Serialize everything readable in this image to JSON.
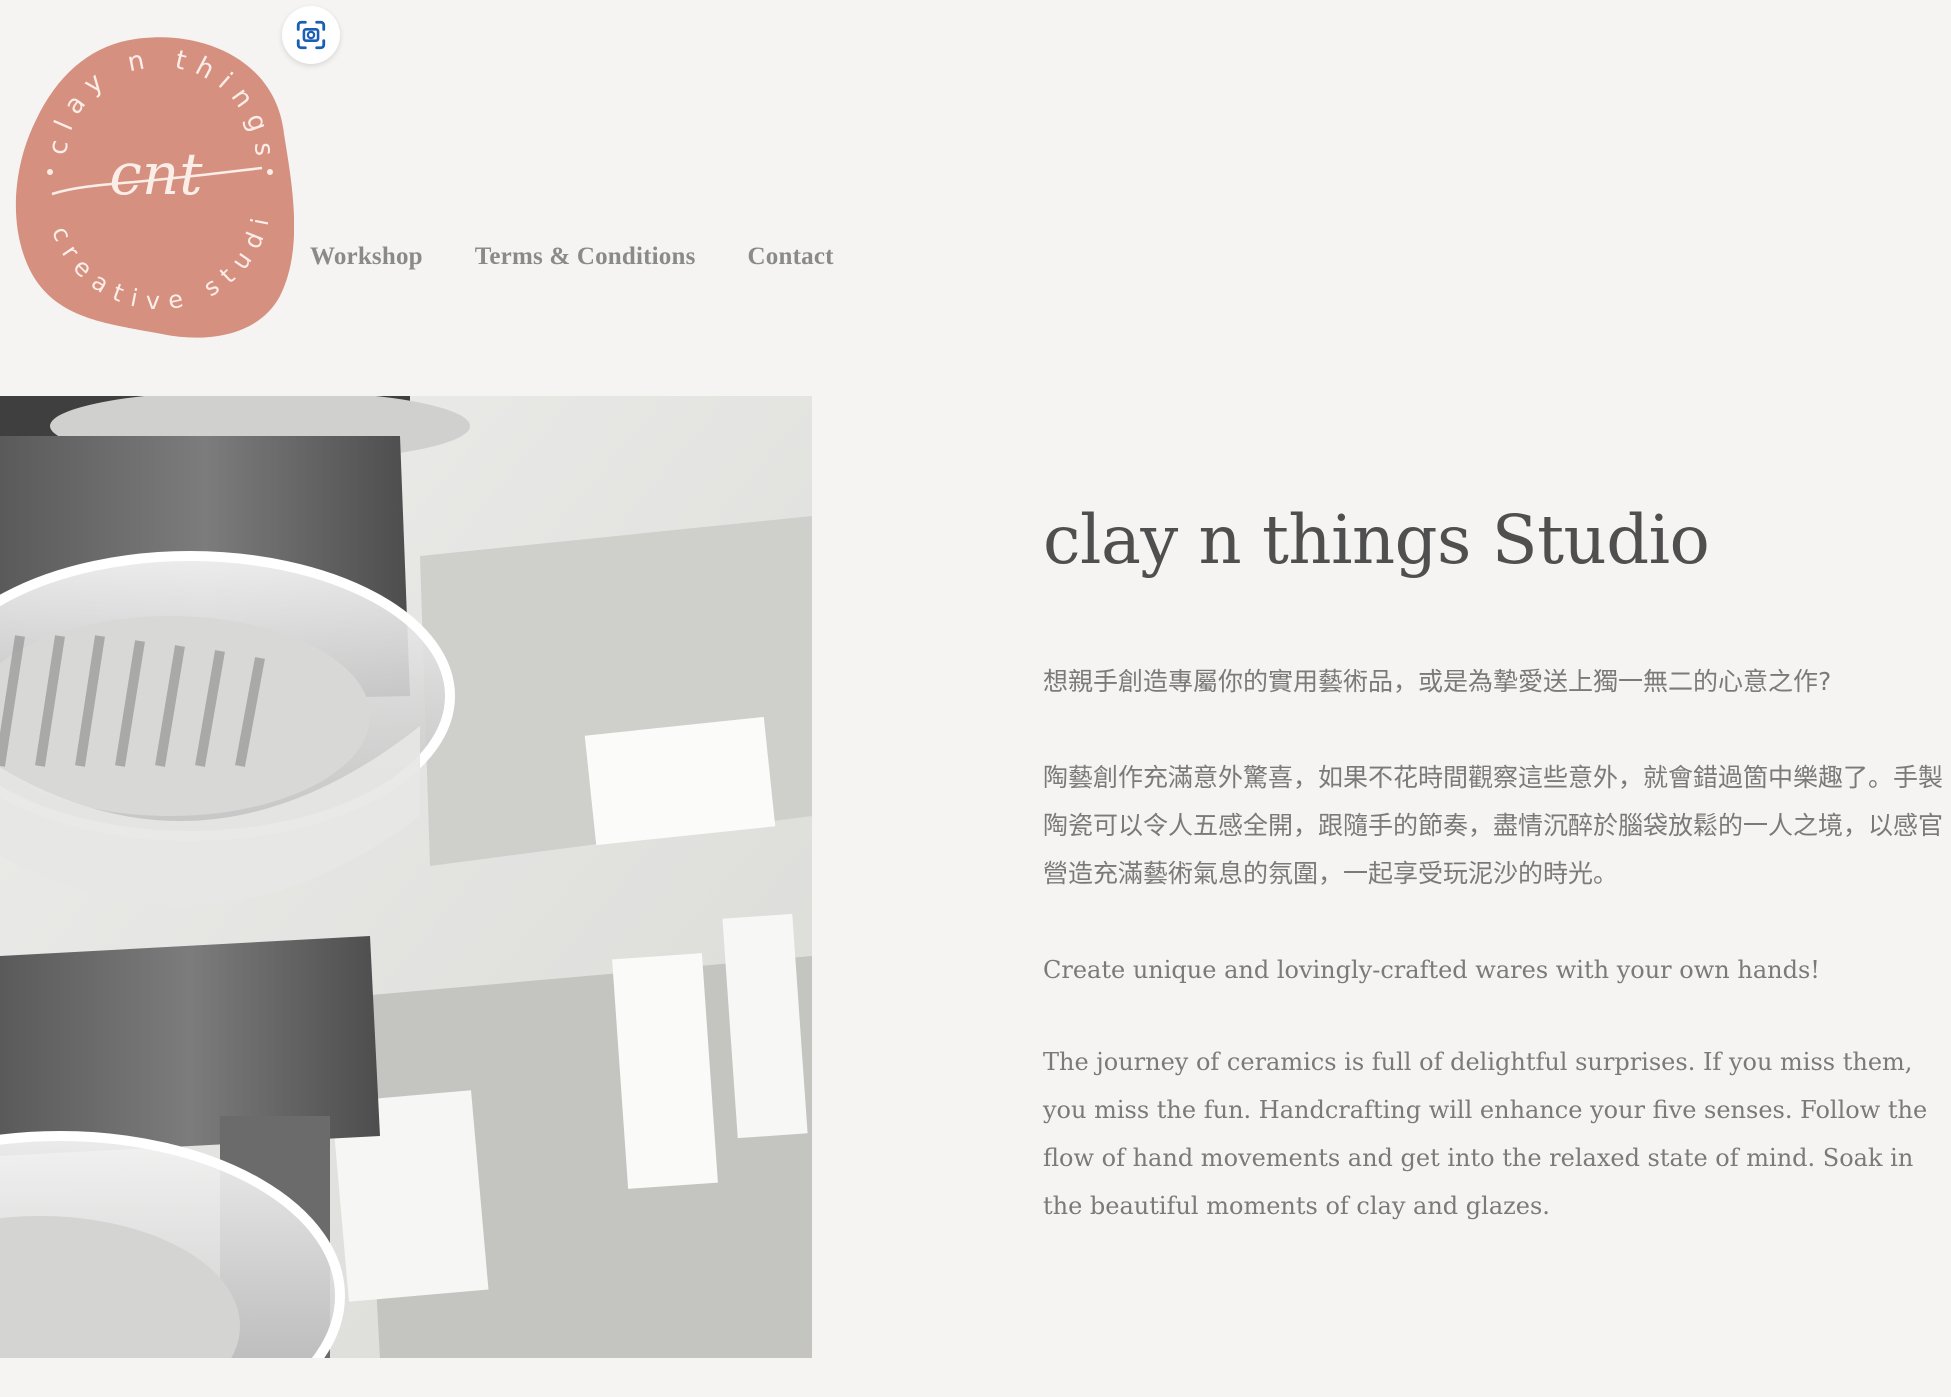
{
  "logo": {
    "monogram": "cnt",
    "top_arc_text": "clay n things",
    "bottom_arc_text": "creative studio",
    "color": "#d6907f"
  },
  "capture_button": {
    "icon": "screenshot-focus-icon",
    "color": "#1a5fb4"
  },
  "nav": {
    "items": [
      {
        "label": "Workshop"
      },
      {
        "label": "Terms & Conditions"
      },
      {
        "label": "Contact"
      }
    ]
  },
  "main": {
    "title": "clay n things Studio",
    "paragraphs": [
      "想親手創造專屬你的實用藝術品，或是為摯愛送上獨一無二的心意之作?",
      "陶藝創作充滿意外驚喜，如果不花時間觀察這些意外，就會錯過箇中樂趣了。手製陶瓷可以令人五感全開，跟隨手的節奏，盡情沉醉於腦袋放鬆的一人之境，以感官營造充滿藝術氣息的氛圍，一起享受玩泥沙的時光。",
      "Create unique and lovingly-crafted wares with your own hands!",
      "The journey of ceramics is full of delightful surprises. If you miss them, you miss the fun. Handcrafting will enhance your five senses. Follow the flow of hand movements and get into the relaxed state of mind. Soak in the beautiful moments of clay and glazes."
    ]
  },
  "colors": {
    "background": "#f5f4f2",
    "text": "#7a7a7a",
    "title": "#4f4f4f",
    "accent": "#d6907f"
  }
}
